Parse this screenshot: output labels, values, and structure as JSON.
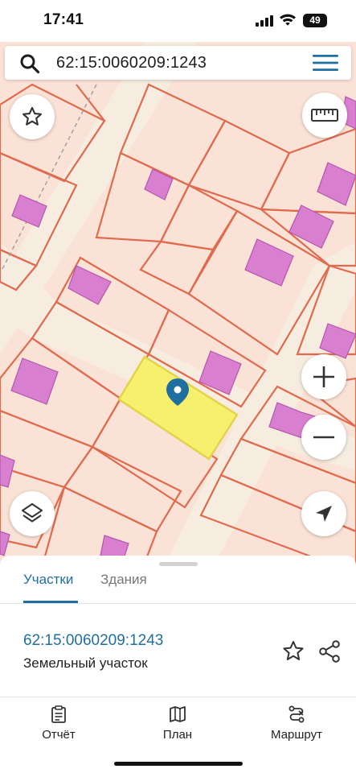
{
  "status_bar": {
    "time": "17:41",
    "battery": "49"
  },
  "search": {
    "query": "62:15:0060209:1243",
    "icon": "search-icon",
    "menu_icon": "hamburger-menu-icon"
  },
  "map": {
    "favorite_icon": "star-icon",
    "ruler_icon": "ruler-icon",
    "zoom_in_icon": "plus-icon",
    "zoom_out_icon": "minus-icon",
    "layers_icon": "layers-icon",
    "locate_icon": "navigation-arrow-icon",
    "marker_icon": "map-pin-icon",
    "colors": {
      "background": "#fbe2d6",
      "parcel_border": "#e06a4e",
      "building_fill": "#d97fcf",
      "selected_parcel": "#f7f06d",
      "road": "#f6ecdf",
      "marker": "#1f6fa0"
    }
  },
  "sheet": {
    "tabs": [
      {
        "label": "Участки",
        "active": true
      },
      {
        "label": "Здания",
        "active": false
      }
    ],
    "result": {
      "number": "62:15:0060209:1243",
      "type": "Земельный участок"
    },
    "actions": {
      "star_icon": "star-outline-icon",
      "share_icon": "share-icon"
    },
    "nav": [
      {
        "label": "Отчёт",
        "icon": "report-icon"
      },
      {
        "label": "План",
        "icon": "map-plan-icon"
      },
      {
        "label": "Маршрут",
        "icon": "route-icon"
      }
    ]
  },
  "accent_color": "#1f6fa0"
}
